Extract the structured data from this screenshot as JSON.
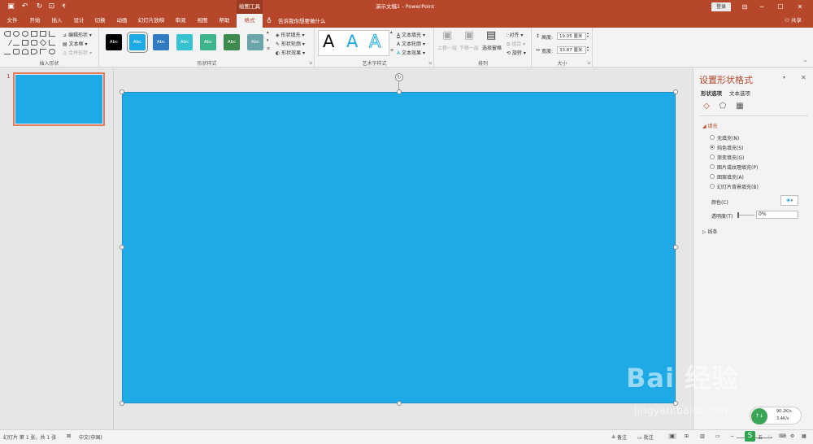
{
  "titlebar": {
    "context_tab": "绘图工具",
    "doc_title": "演示文稿1 - PowerPoint",
    "login": "登录",
    "icons": [
      "save-icon",
      "undo-icon",
      "redo-icon",
      "start-from-beginning-icon",
      "customize-qat-icon"
    ]
  },
  "tabs": [
    "文件",
    "开始",
    "插入",
    "设计",
    "切换",
    "动画",
    "幻灯片放映",
    "审阅",
    "视图",
    "帮助",
    "格式"
  ],
  "active_tab": "格式",
  "tellme": "告诉我你想要做什么",
  "share": "共享",
  "ribbon": {
    "insert_shapes": {
      "label": "插入形状",
      "edit_shape": "编辑形状",
      "text_box": "文本框",
      "merge_shapes": "合并形状"
    },
    "shape_styles": {
      "label": "形状样式",
      "swatches": [
        {
          "text": "Abc",
          "color": "#000000"
        },
        {
          "text": "Abc",
          "color": "#1eaae7"
        },
        {
          "text": "Abc",
          "color": "#2e7bbf"
        },
        {
          "text": "Abc",
          "color": "#35c2d2"
        },
        {
          "text": "Abc",
          "color": "#3cb48d"
        },
        {
          "text": "Abc",
          "color": "#3d8a4d"
        },
        {
          "text": "Abc",
          "color": "#6aa6a8"
        }
      ],
      "fill": "形状填充",
      "outline": "形状轮廓",
      "effects": "形状效果"
    },
    "wordart": {
      "label": "艺术字样式",
      "text_fill": "文本填充",
      "text_outline": "文本轮廓",
      "text_effects": "文本效果",
      "sample": "A"
    },
    "arrange": {
      "label": "排列",
      "bring_forward": "上移一层",
      "send_backward": "下移一层",
      "selection_pane": "选择窗格",
      "align": "对齐",
      "group": "组合",
      "rotate": "旋转"
    },
    "size": {
      "label": "大小",
      "height_label": "高度:",
      "height_value": "19.05 厘米",
      "width_label": "宽度:",
      "width_value": "33.87 厘米"
    }
  },
  "slides_panel": {
    "slide_number": "1"
  },
  "slide": {
    "fill_color": "#1eaae7"
  },
  "format_pane": {
    "title": "设置形状格式",
    "tab_shape": "形状选项",
    "tab_text": "文本选项",
    "section_fill": "填充",
    "fill_options": [
      {
        "label": "无填充(N)",
        "selected": false
      },
      {
        "label": "纯色填充(S)",
        "selected": true
      },
      {
        "label": "渐变填充(G)",
        "selected": false
      },
      {
        "label": "图片或纹理填充(P)",
        "selected": false
      },
      {
        "label": "图案填充(A)",
        "selected": false
      },
      {
        "label": "幻灯片背景填充(B)",
        "selected": false
      }
    ],
    "color_label": "颜色(C)",
    "transparency_label": "透明度(T)",
    "transparency_value": "0%",
    "section_line": "线条"
  },
  "statusbar": {
    "slide_info": "幻灯片 第 1 张，共 1 张",
    "language": "中文(中国)",
    "notes": "备注",
    "comments": "批注"
  },
  "watermark": {
    "text": "Bai 经验",
    "url": "jingyan.baidu.com"
  },
  "netwidget": {
    "up": "90.2K/s",
    "down": "3.4K/s",
    "ime": "S"
  }
}
